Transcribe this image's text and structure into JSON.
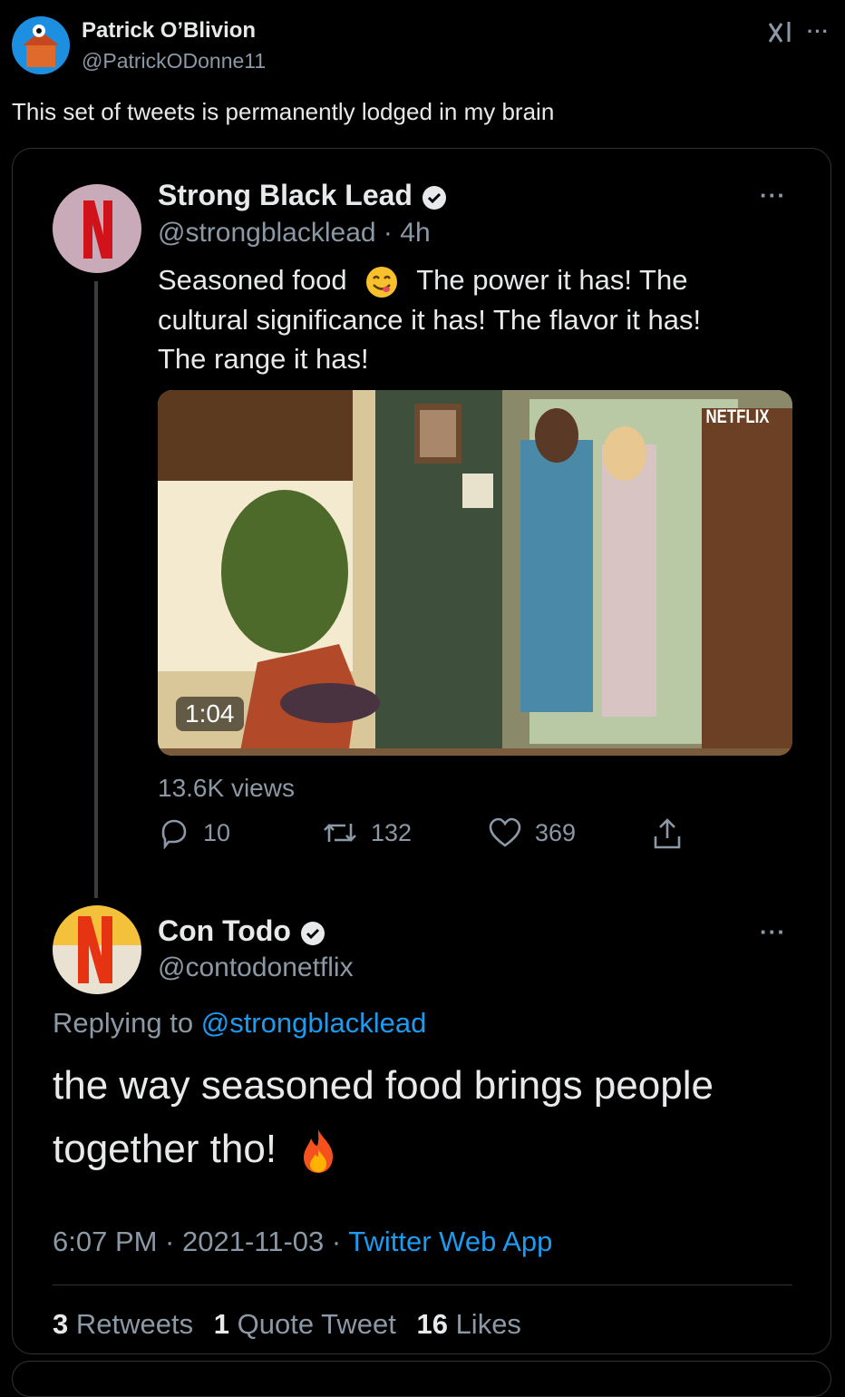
{
  "outer": {
    "author_name": "Patrick O’Blivion",
    "author_handle": "@PatrickODonne11",
    "text": "This set of tweets is permanently lodged in my brain"
  },
  "tweet1": {
    "name": "Strong Black Lead",
    "handle": "@strongblacklead",
    "time": "4h",
    "line1a": "Seasoned food",
    "line1b": "The power it has! The",
    "line2": "cultural significance it has! The flavor it has!",
    "line3": "The range it has!",
    "emoji_icon": "savoring-face-emoji",
    "video": {
      "duration": "1:04",
      "watermark": "NETFLIX"
    },
    "views": "13.6K views",
    "replies": "10",
    "retweets": "132",
    "likes": "369"
  },
  "tweet2": {
    "name": "Con Todo",
    "handle": "@contodonetflix",
    "replying_prefix": "Replying to",
    "replying_to": "@strongblacklead",
    "text_line1": "the way seasoned food brings people",
    "text_line2": "together tho!",
    "emoji_icon": "fire-emoji",
    "timestamp": "6:07 PM · 2021-11-03 · ",
    "source": "Twitter Web App",
    "retweets_count": "3",
    "retweets_label": "Retweets",
    "quote_count": "1",
    "quote_label": "Quote Tweet",
    "likes_count": "16",
    "likes_label": "Likes"
  },
  "colors": {
    "accent": "#1d9bf0",
    "muted": "#8b98a5",
    "netflix_red": "#e50914"
  }
}
